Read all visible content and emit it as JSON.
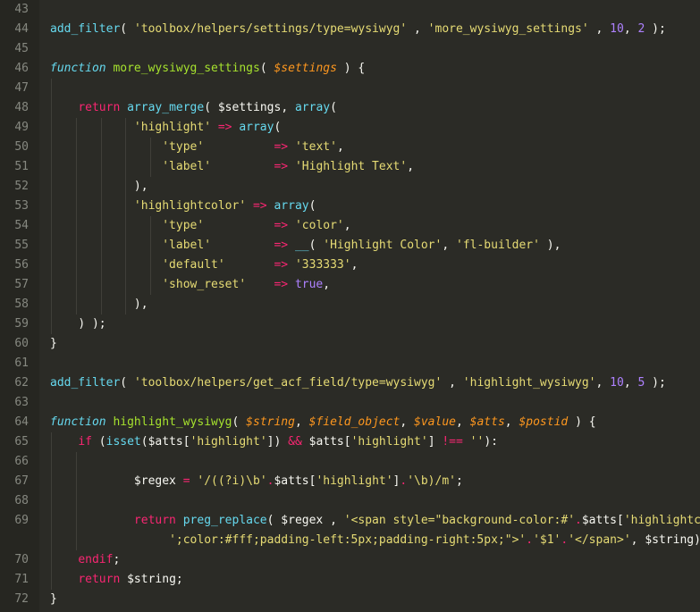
{
  "editor": {
    "name": "code-editor",
    "language": "php",
    "theme": "monokai-dark",
    "colors": {
      "background": "#2b2b26",
      "gutter_background": "#262621",
      "line_number": "#868880",
      "foreground": "#e6e6dc",
      "indent_guide": "#403f39",
      "keyword": "#f92672",
      "function": "#66d9ef",
      "function_name": "#a6e22e",
      "string": "#e6db74",
      "number": "#ae81ff",
      "variable": "#fd971f",
      "operator": "#f92672"
    },
    "first_line_number": 43,
    "last_line_number": 72,
    "line_height_px": 22
  },
  "lines": [
    {
      "n": "43",
      "guides": [],
      "tokens": []
    },
    {
      "n": "44",
      "guides": [],
      "tokens": [
        {
          "t": "add_filter",
          "c": "fn"
        },
        {
          "t": "( ",
          "c": "plain"
        },
        {
          "t": "'toolbox/helpers/settings/type=wysiwyg'",
          "c": "str"
        },
        {
          "t": " , ",
          "c": "plain"
        },
        {
          "t": "'more_wysiwyg_settings'",
          "c": "str"
        },
        {
          "t": " , ",
          "c": "plain"
        },
        {
          "t": "10",
          "c": "num"
        },
        {
          "t": ", ",
          "c": "plain"
        },
        {
          "t": "2",
          "c": "num"
        },
        {
          "t": " );",
          "c": "plain"
        }
      ]
    },
    {
      "n": "45",
      "guides": [],
      "tokens": []
    },
    {
      "n": "46",
      "guides": [],
      "tokens": [
        {
          "t": "function",
          "c": "kwfn"
        },
        {
          "t": " ",
          "c": "plain"
        },
        {
          "t": "more_wysiwyg_settings",
          "c": "fnname"
        },
        {
          "t": "( ",
          "c": "plain"
        },
        {
          "t": "$settings",
          "c": "var"
        },
        {
          "t": " ) {",
          "c": "plain"
        }
      ]
    },
    {
      "n": "47",
      "guides": [
        1
      ],
      "tokens": []
    },
    {
      "n": "48",
      "guides": [
        1
      ],
      "tokens": [
        {
          "t": "    ",
          "c": "plain"
        },
        {
          "t": "return",
          "c": "kw"
        },
        {
          "t": " ",
          "c": "plain"
        },
        {
          "t": "array_merge",
          "c": "fn"
        },
        {
          "t": "( ",
          "c": "plain"
        },
        {
          "t": "$settings",
          "c": "plain"
        },
        {
          "t": ", ",
          "c": "plain"
        },
        {
          "t": "array",
          "c": "fn"
        },
        {
          "t": "(",
          "c": "plain"
        }
      ]
    },
    {
      "n": "49",
      "guides": [
        1,
        2,
        3,
        4
      ],
      "tokens": [
        {
          "t": "            ",
          "c": "plain"
        },
        {
          "t": "'highlight'",
          "c": "str"
        },
        {
          "t": " ",
          "c": "plain"
        },
        {
          "t": "=>",
          "c": "arrow"
        },
        {
          "t": " ",
          "c": "plain"
        },
        {
          "t": "array",
          "c": "fn"
        },
        {
          "t": "(",
          "c": "plain"
        }
      ]
    },
    {
      "n": "50",
      "guides": [
        1,
        2,
        3,
        4,
        5
      ],
      "tokens": [
        {
          "t": "                ",
          "c": "plain"
        },
        {
          "t": "'type'",
          "c": "str"
        },
        {
          "t": "          ",
          "c": "plain"
        },
        {
          "t": "=>",
          "c": "arrow"
        },
        {
          "t": " ",
          "c": "plain"
        },
        {
          "t": "'text'",
          "c": "str"
        },
        {
          "t": ",",
          "c": "plain"
        }
      ]
    },
    {
      "n": "51",
      "guides": [
        1,
        2,
        3,
        4,
        5
      ],
      "tokens": [
        {
          "t": "                ",
          "c": "plain"
        },
        {
          "t": "'label'",
          "c": "str"
        },
        {
          "t": "         ",
          "c": "plain"
        },
        {
          "t": "=>",
          "c": "arrow"
        },
        {
          "t": " ",
          "c": "plain"
        },
        {
          "t": "'Highlight Text'",
          "c": "str"
        },
        {
          "t": ",",
          "c": "plain"
        }
      ]
    },
    {
      "n": "52",
      "guides": [
        1,
        2,
        3,
        4
      ],
      "tokens": [
        {
          "t": "            ",
          "c": "plain"
        },
        {
          "t": "),",
          "c": "plain"
        }
      ]
    },
    {
      "n": "53",
      "guides": [
        1,
        2,
        3,
        4
      ],
      "tokens": [
        {
          "t": "            ",
          "c": "plain"
        },
        {
          "t": "'highlightcolor'",
          "c": "str"
        },
        {
          "t": " ",
          "c": "plain"
        },
        {
          "t": "=>",
          "c": "arrow"
        },
        {
          "t": " ",
          "c": "plain"
        },
        {
          "t": "array",
          "c": "fn"
        },
        {
          "t": "(",
          "c": "plain"
        }
      ]
    },
    {
      "n": "54",
      "guides": [
        1,
        2,
        3,
        4,
        5
      ],
      "tokens": [
        {
          "t": "                ",
          "c": "plain"
        },
        {
          "t": "'type'",
          "c": "str"
        },
        {
          "t": "          ",
          "c": "plain"
        },
        {
          "t": "=>",
          "c": "arrow"
        },
        {
          "t": " ",
          "c": "plain"
        },
        {
          "t": "'color'",
          "c": "str"
        },
        {
          "t": ",",
          "c": "plain"
        }
      ]
    },
    {
      "n": "55",
      "guides": [
        1,
        2,
        3,
        4,
        5
      ],
      "tokens": [
        {
          "t": "                ",
          "c": "plain"
        },
        {
          "t": "'label'",
          "c": "str"
        },
        {
          "t": "         ",
          "c": "plain"
        },
        {
          "t": "=>",
          "c": "arrow"
        },
        {
          "t": " ",
          "c": "plain"
        },
        {
          "t": "__",
          "c": "fn"
        },
        {
          "t": "( ",
          "c": "plain"
        },
        {
          "t": "'Highlight Color'",
          "c": "str"
        },
        {
          "t": ", ",
          "c": "plain"
        },
        {
          "t": "'fl-builder'",
          "c": "str"
        },
        {
          "t": " ),",
          "c": "plain"
        }
      ]
    },
    {
      "n": "56",
      "guides": [
        1,
        2,
        3,
        4,
        5
      ],
      "tokens": [
        {
          "t": "                ",
          "c": "plain"
        },
        {
          "t": "'default'",
          "c": "str"
        },
        {
          "t": "       ",
          "c": "plain"
        },
        {
          "t": "=>",
          "c": "arrow"
        },
        {
          "t": " ",
          "c": "plain"
        },
        {
          "t": "'333333'",
          "c": "str"
        },
        {
          "t": ",",
          "c": "plain"
        }
      ]
    },
    {
      "n": "57",
      "guides": [
        1,
        2,
        3,
        4,
        5
      ],
      "tokens": [
        {
          "t": "                ",
          "c": "plain"
        },
        {
          "t": "'show_reset'",
          "c": "str"
        },
        {
          "t": "    ",
          "c": "plain"
        },
        {
          "t": "=>",
          "c": "arrow"
        },
        {
          "t": " ",
          "c": "plain"
        },
        {
          "t": "true",
          "c": "num"
        },
        {
          "t": ",",
          "c": "plain"
        }
      ]
    },
    {
      "n": "58",
      "guides": [
        1,
        2,
        3,
        4
      ],
      "tokens": [
        {
          "t": "            ",
          "c": "plain"
        },
        {
          "t": "),",
          "c": "plain"
        }
      ]
    },
    {
      "n": "59",
      "guides": [
        1
      ],
      "tokens": [
        {
          "t": "    ",
          "c": "plain"
        },
        {
          "t": ") );",
          "c": "plain"
        }
      ]
    },
    {
      "n": "60",
      "guides": [],
      "tokens": [
        {
          "t": "}",
          "c": "plain"
        }
      ]
    },
    {
      "n": "61",
      "guides": [],
      "tokens": []
    },
    {
      "n": "62",
      "guides": [],
      "tokens": [
        {
          "t": "add_filter",
          "c": "fn"
        },
        {
          "t": "( ",
          "c": "plain"
        },
        {
          "t": "'toolbox/helpers/get_acf_field/type=wysiwyg'",
          "c": "str"
        },
        {
          "t": " , ",
          "c": "plain"
        },
        {
          "t": "'highlight_wysiwyg'",
          "c": "str"
        },
        {
          "t": ", ",
          "c": "plain"
        },
        {
          "t": "10",
          "c": "num"
        },
        {
          "t": ", ",
          "c": "plain"
        },
        {
          "t": "5",
          "c": "num"
        },
        {
          "t": " );",
          "c": "plain"
        }
      ]
    },
    {
      "n": "63",
      "guides": [],
      "tokens": []
    },
    {
      "n": "64",
      "guides": [],
      "tokens": [
        {
          "t": "function",
          "c": "kwfn"
        },
        {
          "t": " ",
          "c": "plain"
        },
        {
          "t": "highlight_wysiwyg",
          "c": "fnname"
        },
        {
          "t": "( ",
          "c": "plain"
        },
        {
          "t": "$string",
          "c": "var"
        },
        {
          "t": ", ",
          "c": "plain"
        },
        {
          "t": "$field_object",
          "c": "var"
        },
        {
          "t": ", ",
          "c": "plain"
        },
        {
          "t": "$value",
          "c": "var"
        },
        {
          "t": ", ",
          "c": "plain"
        },
        {
          "t": "$atts",
          "c": "var"
        },
        {
          "t": ", ",
          "c": "plain"
        },
        {
          "t": "$postid",
          "c": "var"
        },
        {
          "t": " ) {",
          "c": "plain"
        }
      ]
    },
    {
      "n": "65",
      "guides": [
        1
      ],
      "tokens": [
        {
          "t": "    ",
          "c": "plain"
        },
        {
          "t": "if",
          "c": "kw"
        },
        {
          "t": " (",
          "c": "plain"
        },
        {
          "t": "isset",
          "c": "fn"
        },
        {
          "t": "(",
          "c": "plain"
        },
        {
          "t": "$atts",
          "c": "plain"
        },
        {
          "t": "[",
          "c": "plain"
        },
        {
          "t": "'highlight'",
          "c": "str"
        },
        {
          "t": "]) ",
          "c": "plain"
        },
        {
          "t": "&&",
          "c": "op"
        },
        {
          "t": " ",
          "c": "plain"
        },
        {
          "t": "$atts",
          "c": "plain"
        },
        {
          "t": "[",
          "c": "plain"
        },
        {
          "t": "'highlight'",
          "c": "str"
        },
        {
          "t": "] ",
          "c": "plain"
        },
        {
          "t": "!==",
          "c": "op"
        },
        {
          "t": " ",
          "c": "plain"
        },
        {
          "t": "''",
          "c": "str"
        },
        {
          "t": "):",
          "c": "plain"
        }
      ]
    },
    {
      "n": "66",
      "guides": [
        1,
        2
      ],
      "tokens": []
    },
    {
      "n": "67",
      "guides": [
        1,
        2
      ],
      "tokens": [
        {
          "t": "            ",
          "c": "plain"
        },
        {
          "t": "$regex",
          "c": "plain"
        },
        {
          "t": " ",
          "c": "plain"
        },
        {
          "t": "=",
          "c": "op"
        },
        {
          "t": " ",
          "c": "plain"
        },
        {
          "t": "'/((?i)\\b'",
          "c": "str"
        },
        {
          "t": ".",
          "c": "op"
        },
        {
          "t": "$atts",
          "c": "plain"
        },
        {
          "t": "[",
          "c": "plain"
        },
        {
          "t": "'highlight'",
          "c": "str"
        },
        {
          "t": "]",
          "c": "plain"
        },
        {
          "t": ".",
          "c": "op"
        },
        {
          "t": "'\\b)/m'",
          "c": "str"
        },
        {
          "t": ";",
          "c": "plain"
        }
      ]
    },
    {
      "n": "68",
      "guides": [
        1,
        2
      ],
      "tokens": []
    },
    {
      "n": "69",
      "guides": [
        1,
        2
      ],
      "tokens": [
        {
          "t": "            ",
          "c": "plain"
        },
        {
          "t": "return",
          "c": "kw"
        },
        {
          "t": " ",
          "c": "plain"
        },
        {
          "t": "preg_replace",
          "c": "fn"
        },
        {
          "t": "( ",
          "c": "plain"
        },
        {
          "t": "$regex",
          "c": "plain"
        },
        {
          "t": " , ",
          "c": "plain"
        },
        {
          "t": "'<span style=\"background-color:#'",
          "c": "str"
        },
        {
          "t": ".",
          "c": "op"
        },
        {
          "t": "$atts",
          "c": "plain"
        },
        {
          "t": "[",
          "c": "plain"
        },
        {
          "t": "'highlightcolor'",
          "c": "str"
        },
        {
          "t": "]",
          "c": "plain"
        },
        {
          "t": ".",
          "c": "op"
        }
      ]
    },
    {
      "n": "",
      "guides": [
        1,
        2
      ],
      "tokens": [
        {
          "t": "                 ",
          "c": "plain"
        },
        {
          "t": "';color:#fff;padding-left:5px;padding-right:5px;\">'",
          "c": "str"
        },
        {
          "t": ".",
          "c": "op"
        },
        {
          "t": "'$1'",
          "c": "str"
        },
        {
          "t": ".",
          "c": "op"
        },
        {
          "t": "'</span>'",
          "c": "str"
        },
        {
          "t": ", ",
          "c": "plain"
        },
        {
          "t": "$string",
          "c": "plain"
        },
        {
          "t": ");",
          "c": "plain"
        }
      ]
    },
    {
      "n": "70",
      "guides": [
        1
      ],
      "tokens": [
        {
          "t": "    ",
          "c": "plain"
        },
        {
          "t": "endif",
          "c": "kw"
        },
        {
          "t": ";",
          "c": "plain"
        }
      ]
    },
    {
      "n": "71",
      "guides": [
        1
      ],
      "tokens": [
        {
          "t": "    ",
          "c": "plain"
        },
        {
          "t": "return",
          "c": "kw"
        },
        {
          "t": " ",
          "c": "plain"
        },
        {
          "t": "$string",
          "c": "plain"
        },
        {
          "t": ";",
          "c": "plain"
        }
      ]
    },
    {
      "n": "72",
      "guides": [],
      "tokens": [
        {
          "t": "}",
          "c": "plain"
        }
      ]
    }
  ]
}
